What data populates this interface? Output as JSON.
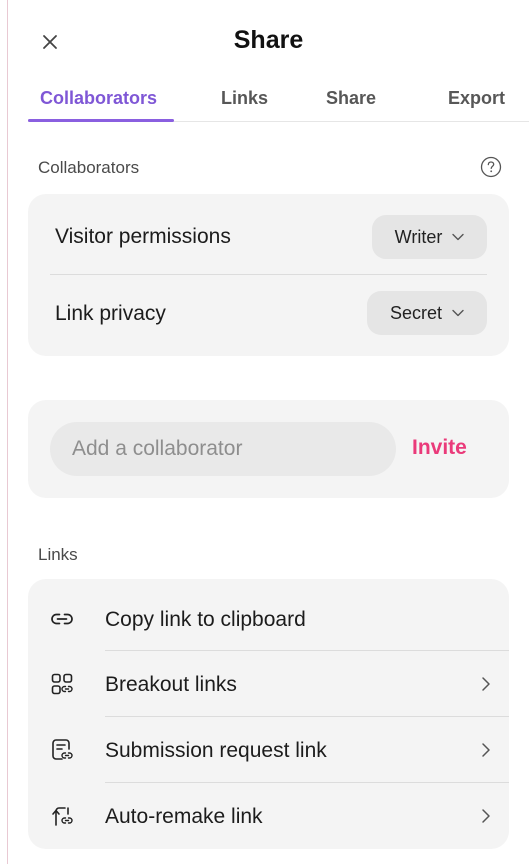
{
  "header": {
    "title": "Share"
  },
  "tabs": [
    {
      "label": "Collaborators",
      "active": true
    },
    {
      "label": "Links",
      "active": false
    },
    {
      "label": "Share",
      "active": false
    },
    {
      "label": "Export",
      "active": false
    }
  ],
  "collaborators": {
    "section_label": "Collaborators",
    "permissions": {
      "label": "Visitor permissions",
      "value": "Writer"
    },
    "privacy": {
      "label": "Link privacy",
      "value": "Secret"
    },
    "add": {
      "placeholder": "Add a collaborator",
      "invite_label": "Invite"
    }
  },
  "links": {
    "section_label": "Links",
    "items": [
      {
        "label": "Copy link to clipboard",
        "icon": "link-icon",
        "has_chevron": false
      },
      {
        "label": "Breakout links",
        "icon": "breakout-links-icon",
        "has_chevron": true
      },
      {
        "label": "Submission request link",
        "icon": "submission-request-icon",
        "has_chevron": true
      },
      {
        "label": "Auto-remake link",
        "icon": "auto-remake-icon",
        "has_chevron": true
      }
    ]
  },
  "colors": {
    "accent_purple": "#7f57d6",
    "invite_pink": "#ea3a7a",
    "card_bg": "#f4f4f4"
  }
}
